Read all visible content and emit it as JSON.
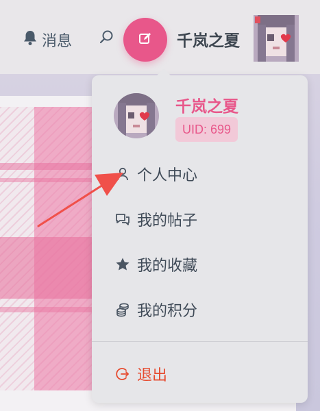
{
  "header": {
    "messages_label": "消息",
    "username": "千岚之夏",
    "icons": {
      "bell": "bell-icon",
      "search": "search-icon",
      "compose": "edit-icon"
    }
  },
  "dropdown": {
    "username": "千岚之夏",
    "uid": "UID: 699",
    "items": [
      {
        "label": "个人中心",
        "icon": "user-icon"
      },
      {
        "label": "我的帖子",
        "icon": "chat-icon"
      },
      {
        "label": "我的收藏",
        "icon": "star-icon"
      },
      {
        "label": "我的积分",
        "icon": "coins-icon"
      }
    ],
    "logout_label": "退出"
  },
  "colors": {
    "accent": "#e8578a",
    "logout": "#e64a2e",
    "text": "#3f4a57",
    "arrow": "#f0504a"
  }
}
